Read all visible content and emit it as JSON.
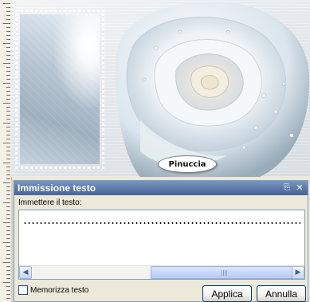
{
  "canvas": {
    "badge_text": "Pinuccia"
  },
  "panel": {
    "title": "Immissione testo",
    "pin_icon": "pin-icon",
    "close_icon": "close-icon",
    "prompt_label": "Immettere il testo:",
    "text_value": "",
    "remember_label": "Memorizza testo",
    "remember_checked": false,
    "apply_label": "Applica",
    "cancel_label": "Annulla"
  }
}
